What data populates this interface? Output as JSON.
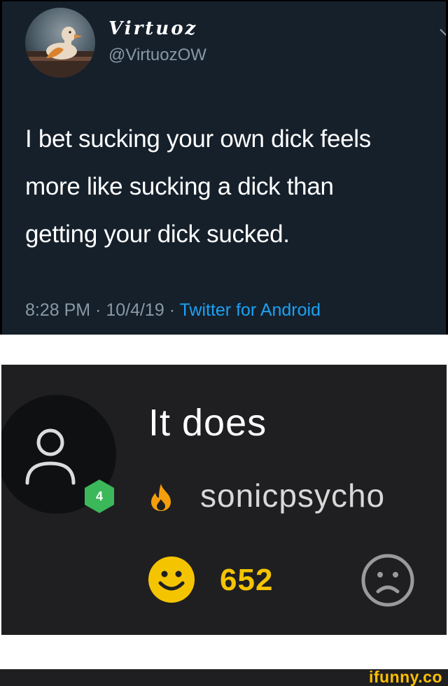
{
  "tweet": {
    "display_name": "Virtuoz",
    "handle": "@VirtuozOW",
    "text_lines": [
      "I bet sucking your own dick feels",
      "more like sucking a dick than",
      "getting your dick sucked."
    ],
    "time": "8:28 PM",
    "date": "10/4/19",
    "source": "Twitter for Android",
    "separator": " · ",
    "avatar_icon": "duck-photo",
    "menu_icon": "chevron-down-icon"
  },
  "comment": {
    "text": "It does",
    "username": "sonicpsycho",
    "level": "4",
    "score": "652",
    "user_icon": "user-icon",
    "flame_icon": "flame-icon",
    "upvote_icon": "smile-icon",
    "downvote_icon": "sad-face-icon"
  },
  "footer": {
    "brand": "ifunny.co"
  },
  "colors": {
    "tweet_bg": "#15202b",
    "tweet_secondary": "#8899a6",
    "link_blue": "#1da1f2",
    "comment_bg": "#1f1f21",
    "level_green": "#3bb85a",
    "flame_orange": "#f59e0b",
    "smile_yellow": "#f5c400",
    "brand_yellow": "#ffc000"
  }
}
